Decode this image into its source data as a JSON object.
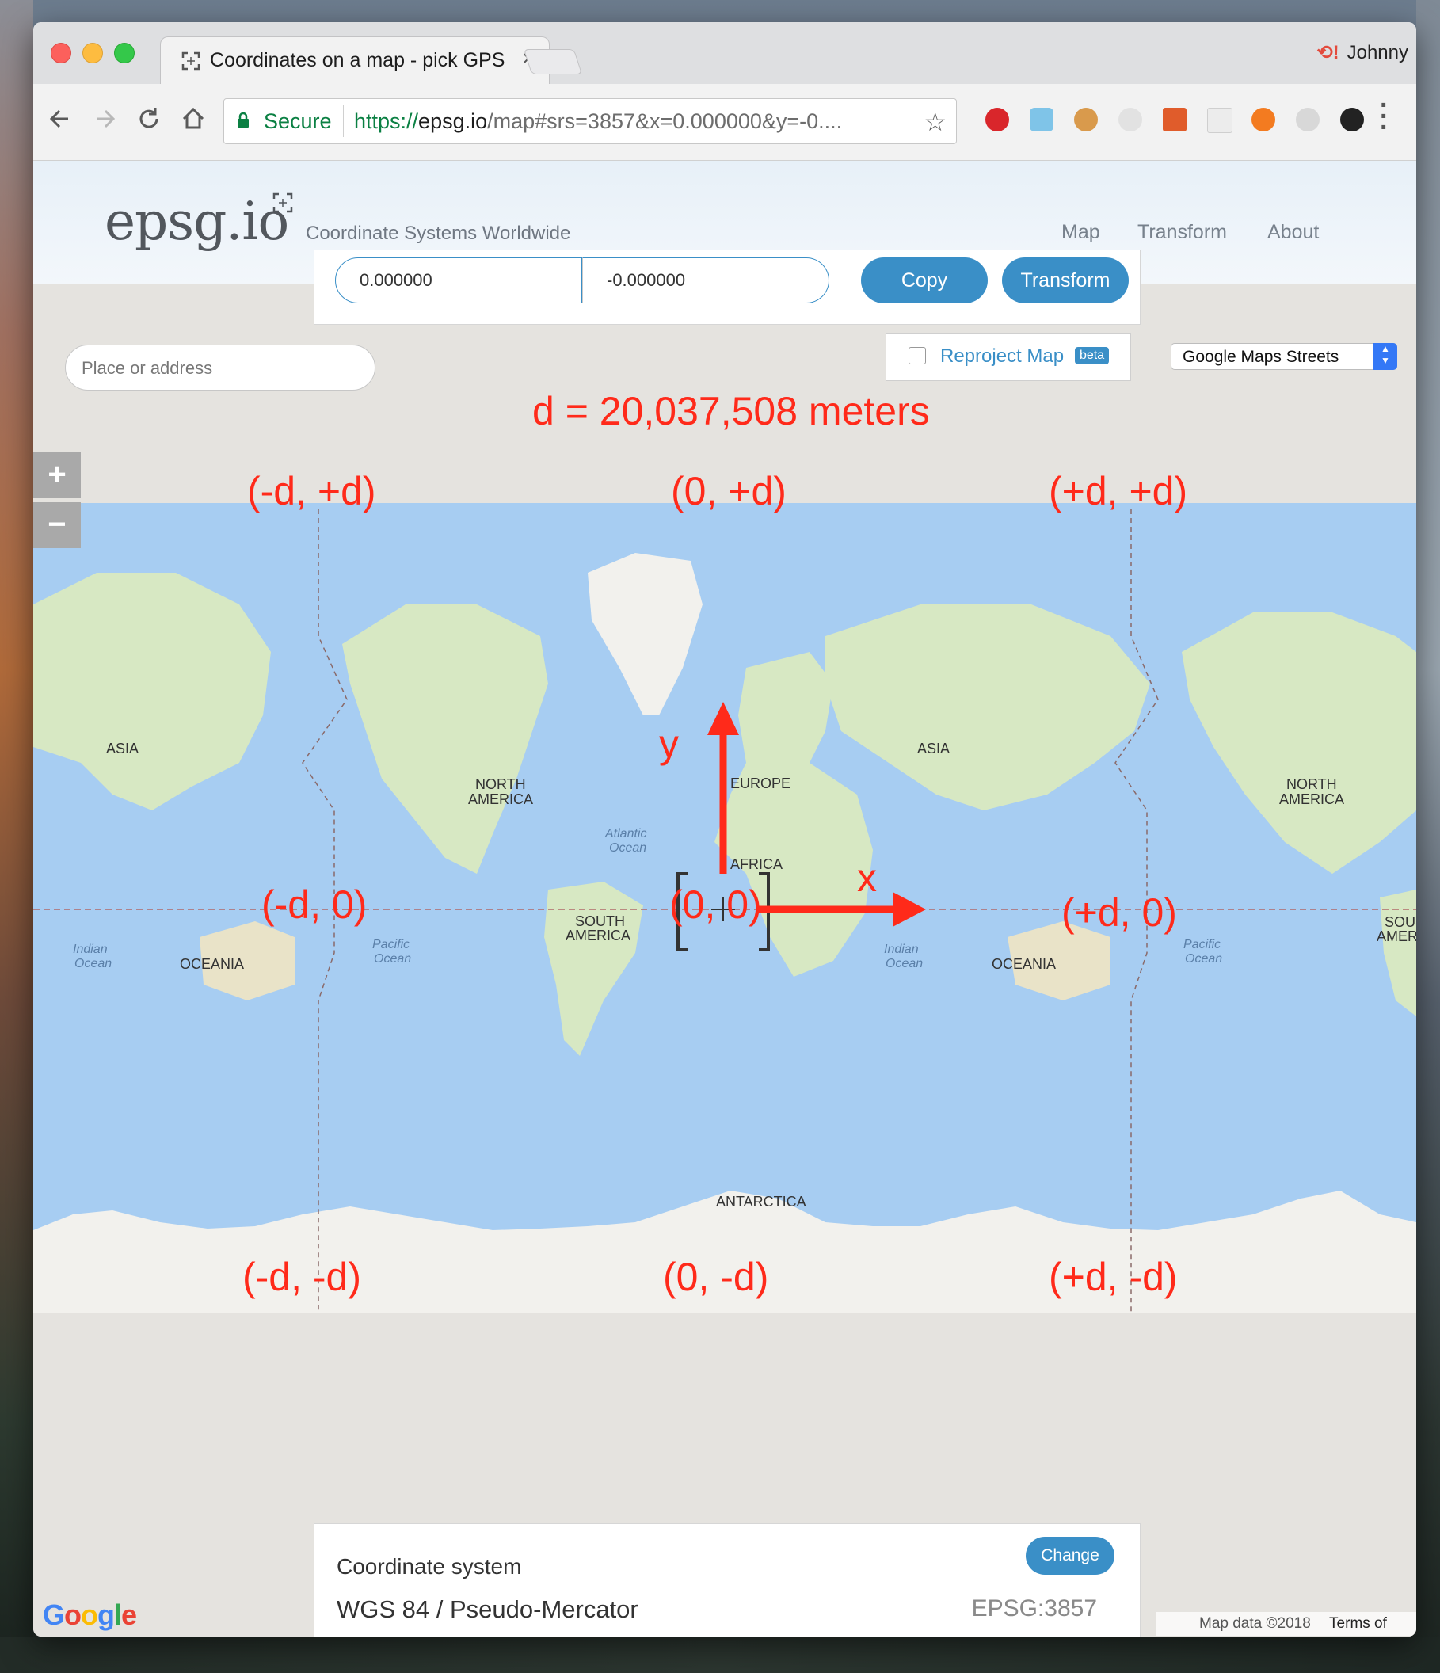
{
  "browser": {
    "tab_title": "Coordinates on a map - pick GPS",
    "profile_name": "Johnny",
    "secure_label": "Secure",
    "url_scheme": "https://",
    "url_host": "epsg.io",
    "url_rest": "/map#srs=3857&x=0.000000&y=-0....",
    "extensions": [
      "pinterest-icon",
      "bookmark-heart-icon",
      "cookie-icon",
      "shield-icon",
      "tiles-icon",
      "card-icon",
      "lifebuoy-icon",
      "react-icon",
      "github-icon"
    ]
  },
  "site": {
    "logo": "epsg.io",
    "tagline": "Coordinate Systems Worldwide",
    "nav": [
      "Map",
      "Transform",
      "About"
    ]
  },
  "coords": {
    "x_value": "0.000000",
    "y_value": "-0.000000",
    "copy_label": "Copy",
    "transform_label": "Transform"
  },
  "search": {
    "placeholder": "Place or address"
  },
  "reproject": {
    "label": "Reproject Map",
    "badge": "beta",
    "checked": false
  },
  "layer": {
    "selected": "Google Maps Streets"
  },
  "zoom": {
    "in": "+",
    "out": "−"
  },
  "annotations": {
    "title": "d = 20,037,508 meters",
    "top_left": "(-d, +d)",
    "top_center": "(0, +d)",
    "top_right": "(+d, +d)",
    "mid_left": "(-d, 0)",
    "mid_center": "(0, 0)",
    "mid_right": "(+d, 0)",
    "bottom_left": "(-d, -d)",
    "bottom_center": "(0, -d)",
    "bottom_right": "(+d, -d)",
    "y_axis": "y",
    "x_axis": "x",
    "color": "#ff2a1a"
  },
  "map_labels": {
    "asia": "ASIA",
    "north_america": "NORTH\nAMERICA",
    "europe": "EUROPE",
    "africa": "AFRICA",
    "south_america": "SOUTH\nAMERICA",
    "oceania": "OCEANIA",
    "antarctica": "ANTARCTICA",
    "atlantic": "Atlantic\nOcean",
    "pacific": "Pacific\nOcean",
    "indian": "Indian\nOcean",
    "partial_south_america": "SOU\nAMER"
  },
  "coordinate_system": {
    "title": "Coordinate system",
    "name": "WGS 84 / Pseudo-Mercator",
    "code": "EPSG:3857",
    "change_label": "Change"
  },
  "footer": {
    "google": "Google",
    "map_data": "Map data ©2018",
    "terms": "Terms of Use"
  },
  "colors": {
    "ocean": "#a7cdf2",
    "land": "#d7e8c3",
    "ice": "#f2f1ed",
    "accent": "#3a8fc7"
  }
}
